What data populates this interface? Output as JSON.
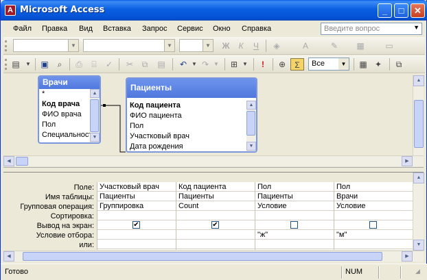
{
  "window": {
    "title": "Microsoft Access",
    "icon_label": "A"
  },
  "menu": [
    "Файл",
    "Правка",
    "Вид",
    "Вставка",
    "Запрос",
    "Сервис",
    "Окно",
    "Справка"
  ],
  "help": {
    "placeholder": "Введите вопрос"
  },
  "toolbar": {
    "top_values_combo": "Все"
  },
  "tables": [
    {
      "name": "Врачи",
      "fields": [
        "*",
        "Код врача",
        "ФИО врача",
        "Пол",
        "Специальность"
      ],
      "pk": "Код врача"
    },
    {
      "name": "Пациенты",
      "fields": [
        "Код пациента",
        "ФИО пациента",
        "Пол",
        "Участковый врач",
        "Дата рождения"
      ],
      "pk": "Код пациента"
    }
  ],
  "grid": {
    "row_labels": [
      "Поле:",
      "Имя таблицы:",
      "Групповая операция:",
      "Сортировка:",
      "Вывод на экран:",
      "Условие отбора:",
      "или:"
    ],
    "columns": [
      {
        "field": "Участковый врач",
        "table": "Пациенты",
        "group": "Группировка",
        "sort": "",
        "show": true,
        "criteria": "",
        "or": ""
      },
      {
        "field": "Код пациента",
        "table": "Пациенты",
        "group": "Count",
        "sort": "",
        "show": true,
        "criteria": "",
        "or": ""
      },
      {
        "field": "Пол",
        "table": "Пациенты",
        "group": "Условие",
        "sort": "",
        "show": false,
        "criteria": "\"ж\"",
        "or": ""
      },
      {
        "field": "Пол",
        "table": "Врачи",
        "group": "Условие",
        "sort": "",
        "show": false,
        "criteria": "\"м\"",
        "or": ""
      }
    ]
  },
  "status": {
    "text": "Готово",
    "num": "NUM"
  }
}
